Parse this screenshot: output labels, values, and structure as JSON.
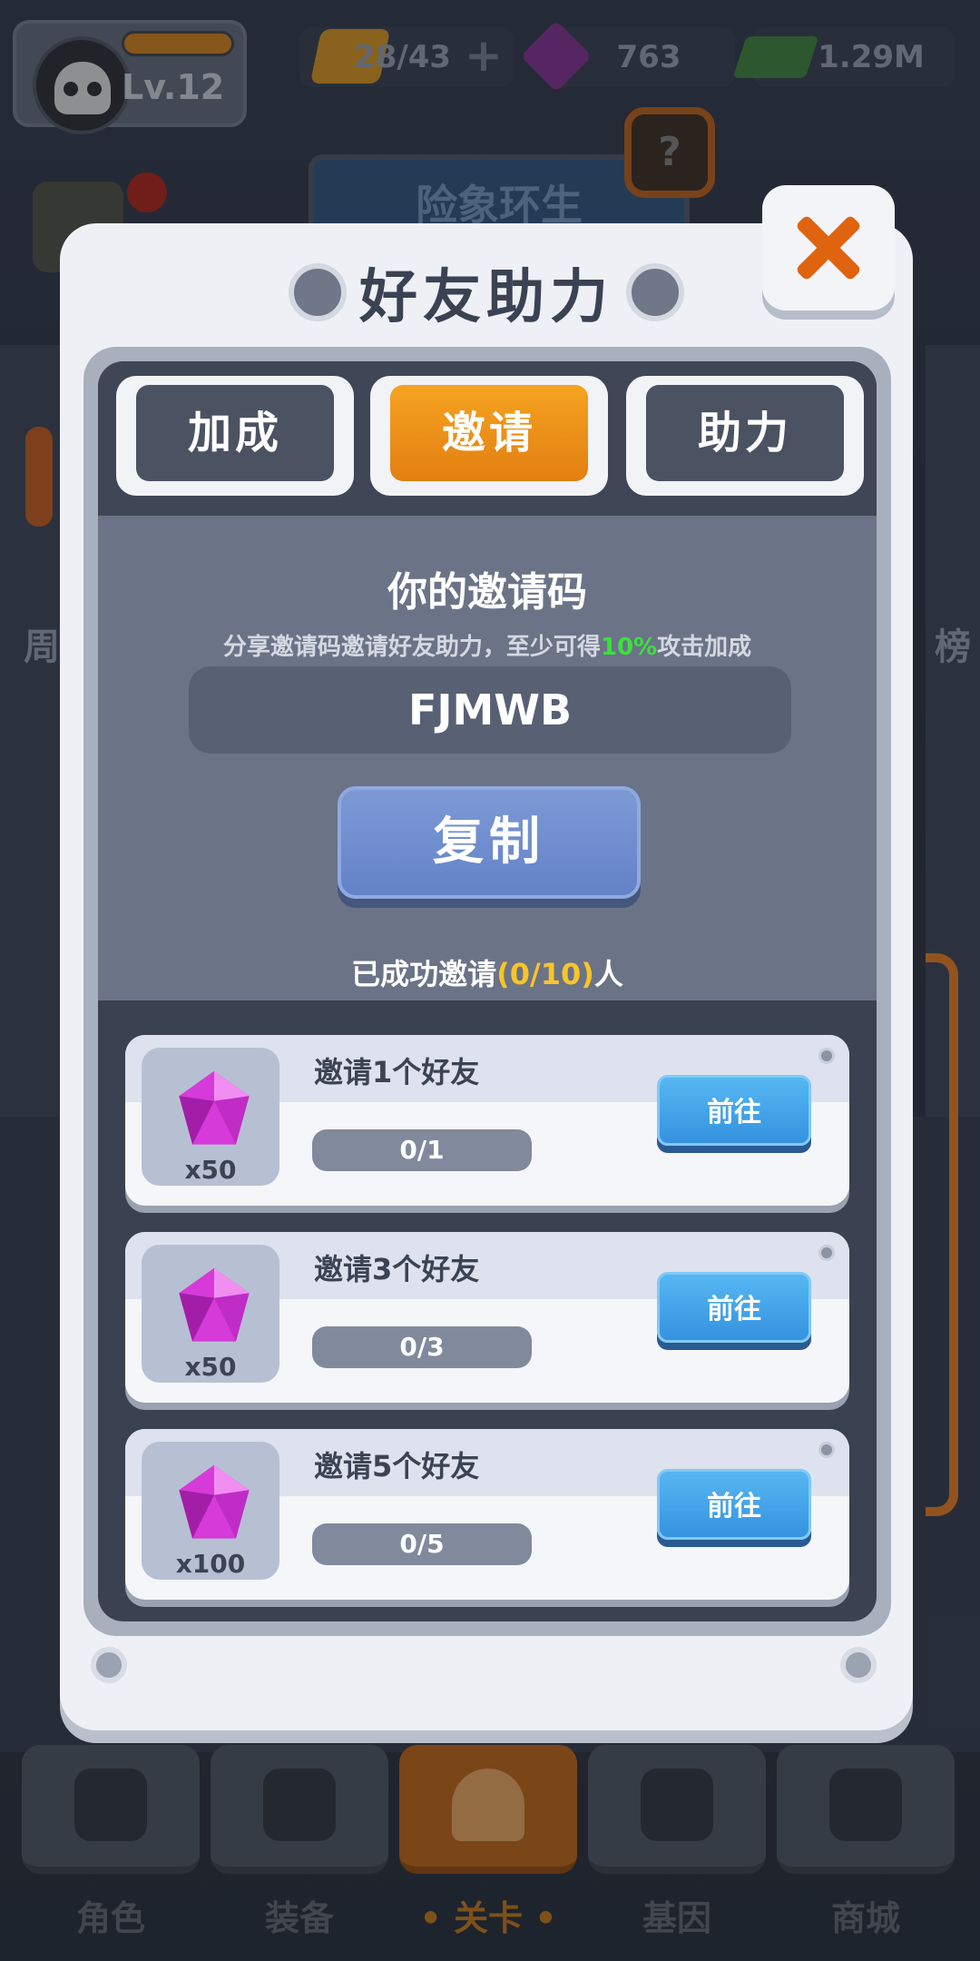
{
  "hud": {
    "level": "Lv.12",
    "energy": "28/43",
    "gems": "763",
    "cash": "1.29M"
  },
  "background": {
    "stage_name": "险象环生",
    "help_badge": "?",
    "left_side_label": "周",
    "right_side_label": "榜"
  },
  "bottom_nav": [
    {
      "label": "角色",
      "icon": "skull-icon"
    },
    {
      "label": "装备",
      "icon": "gun-icon"
    },
    {
      "label": "• 关卡 •",
      "icon": "map-pin-icon"
    },
    {
      "label": "基因",
      "icon": "hexagon-icon"
    },
    {
      "label": "商城",
      "icon": "shop-icon"
    }
  ],
  "dialog": {
    "title": "好友助力",
    "close_icon": "close-icon",
    "tabs": [
      {
        "label": "加成",
        "active": false
      },
      {
        "label": "邀请",
        "active": true
      },
      {
        "label": "助力",
        "active": false
      }
    ],
    "invite": {
      "title": "你的邀请码",
      "subtitle_prefix": "分享邀请码邀请好友助力，至少可得",
      "subtitle_highlight": "10%",
      "subtitle_suffix": "攻击加成",
      "code": "FJMWB",
      "copy_label": "复制",
      "success_prefix": "已成功邀请",
      "success_count": "(0/10)",
      "success_suffix": "人"
    },
    "quests": [
      {
        "title": "邀请1个好友",
        "reward": "x50",
        "progress_text": "0/1",
        "progress": 0,
        "button": "前往"
      },
      {
        "title": "邀请3个好友",
        "reward": "x50",
        "progress_text": "0/3",
        "progress": 0,
        "button": "前往"
      },
      {
        "title": "邀请5个好友",
        "reward": "x100",
        "progress_text": "0/5",
        "progress": 0,
        "button": "前往"
      }
    ]
  },
  "colors": {
    "accent_orange": "#e37f10",
    "copy_blue": "#6382c7",
    "go_blue": "#3592e0",
    "highlight_green": "#3ce03c",
    "highlight_yellow": "#f7c52a",
    "gem_pink": "#d63ad8"
  }
}
